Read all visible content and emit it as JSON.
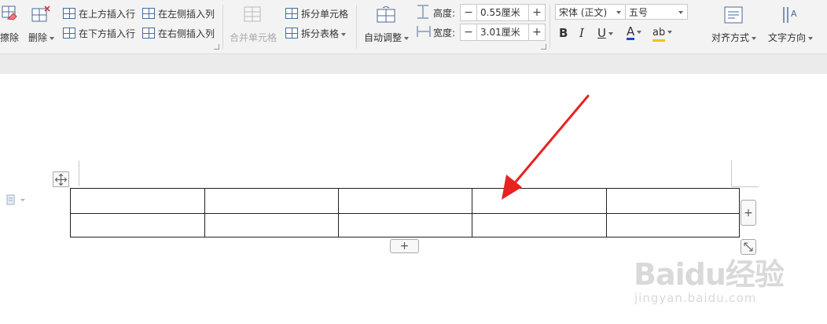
{
  "ribbon": {
    "eraser_label": "擦除",
    "delete_label": "删除",
    "insert_above_label": "在上方插入行",
    "insert_below_label": "在下方插入行",
    "insert_left_label": "在左侧插入列",
    "insert_right_label": "在右侧插入列",
    "merge_cells_label": "合并单元格",
    "split_cells_label": "拆分单元格",
    "split_table_label": "拆分表格",
    "auto_adjust_label": "自动调整",
    "height_label": "高度:",
    "height_value": "0.55厘米",
    "width_label": "宽度:",
    "width_value": "3.01厘米",
    "font_name": "宋体 (正文)",
    "font_size": "五号",
    "bold": "B",
    "italic": "I",
    "underline": "U",
    "font_color": "A",
    "highlight": "ab",
    "align_label": "对齐方式",
    "text_direction_label": "文字方向"
  },
  "spinner": {
    "minus": "−",
    "plus": "+"
  },
  "table": {
    "rows": 2,
    "cols": 5
  },
  "controls": {
    "add_row": "+",
    "add_col": "+"
  },
  "watermark": {
    "logo_text": "Baidu经验",
    "url": "jingyan.baidu.com"
  },
  "colors": {
    "arrow": "#e8231f",
    "font_color_bar": "#1a49c8",
    "highlight_bar": "#f2c200"
  }
}
